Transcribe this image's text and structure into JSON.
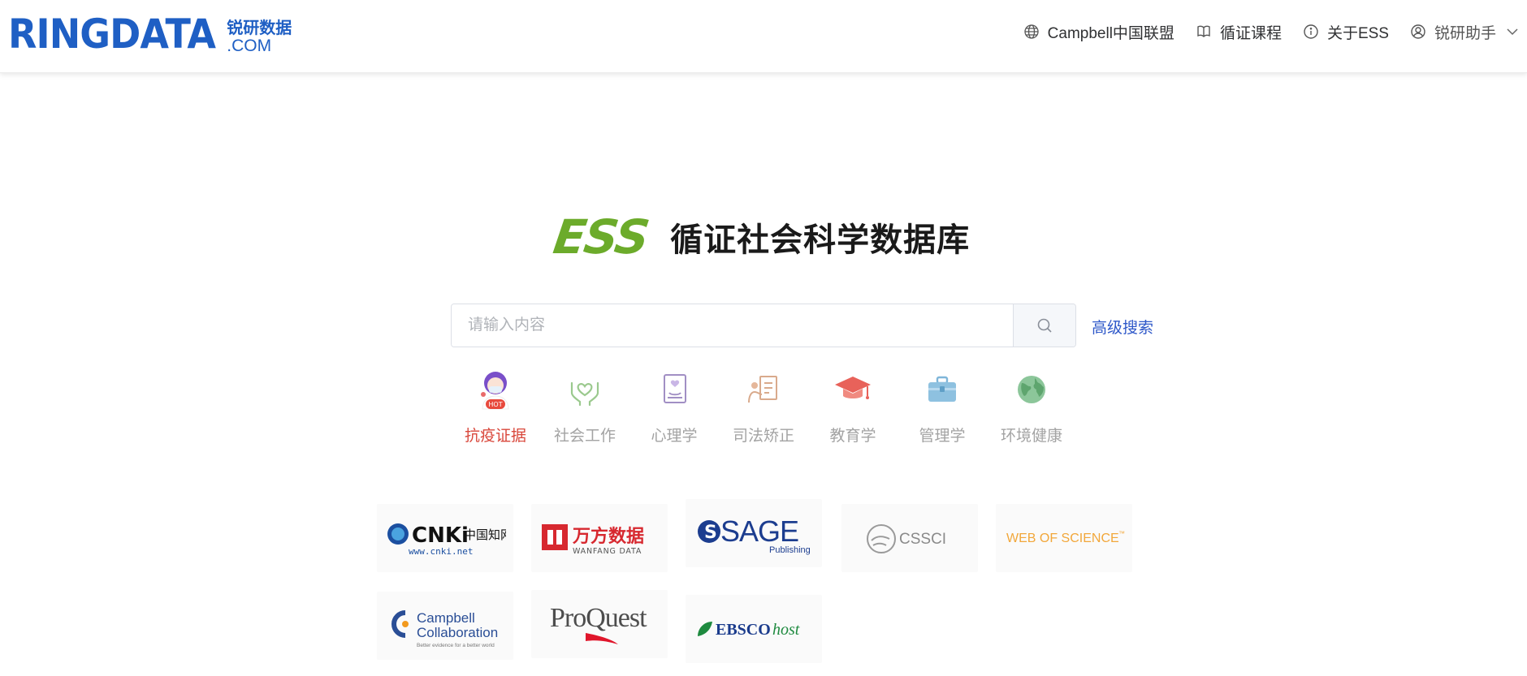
{
  "header": {
    "logo_main": "RINGDATA",
    "logo_cn": "锐研数据",
    "logo_com": ".COM",
    "nav": [
      {
        "label": "Campbell中国联盟",
        "icon": "globe-icon"
      },
      {
        "label": "循证课程",
        "icon": "book-icon"
      },
      {
        "label": "关于ESS",
        "icon": "info-icon"
      },
      {
        "label": "锐研助手",
        "icon": "user-icon"
      }
    ]
  },
  "main": {
    "ess_logo": "ESS",
    "title": "循证社会科学数据库",
    "search": {
      "placeholder": "请输入内容",
      "value": ""
    },
    "advanced_search": "高级搜索",
    "categories": [
      {
        "label": "抗疫证据",
        "active": true,
        "icon": "hot-doctor-icon",
        "badge": "HOT"
      },
      {
        "label": "社会工作",
        "active": false,
        "icon": "heart-hands-icon"
      },
      {
        "label": "心理学",
        "active": false,
        "icon": "psychology-book-icon"
      },
      {
        "label": "司法矫正",
        "active": false,
        "icon": "judge-board-icon"
      },
      {
        "label": "教育学",
        "active": false,
        "icon": "graduation-cap-icon"
      },
      {
        "label": "管理学",
        "active": false,
        "icon": "briefcase-icon"
      },
      {
        "label": "环境健康",
        "active": false,
        "icon": "globe-earth-icon"
      }
    ]
  },
  "partners": {
    "cnki_main": "CNKi",
    "cnki_cn": "中国知网",
    "cnki_url": "www.cnki.net",
    "wanfang_cn": "万方数据",
    "wanfang_en": "WANFANG DATA",
    "sage": "SAGE",
    "sage_sub": "Publishing",
    "cssci": "CSSCI",
    "wos": "WEB OF SCIENCE",
    "wos_tm": "™",
    "campbell_1": "Campbell",
    "campbell_2": "Collaboration",
    "campbell_tag": "Better evidence for a better world",
    "proquest": "ProQuest",
    "ebsco_main": "EBSCO",
    "ebsco_host": "host"
  },
  "colors": {
    "brand_blue": "#1f5fc4",
    "ess_green": "#6cab2b",
    "active_red": "#d9473b",
    "link_blue": "#2e58c9"
  }
}
